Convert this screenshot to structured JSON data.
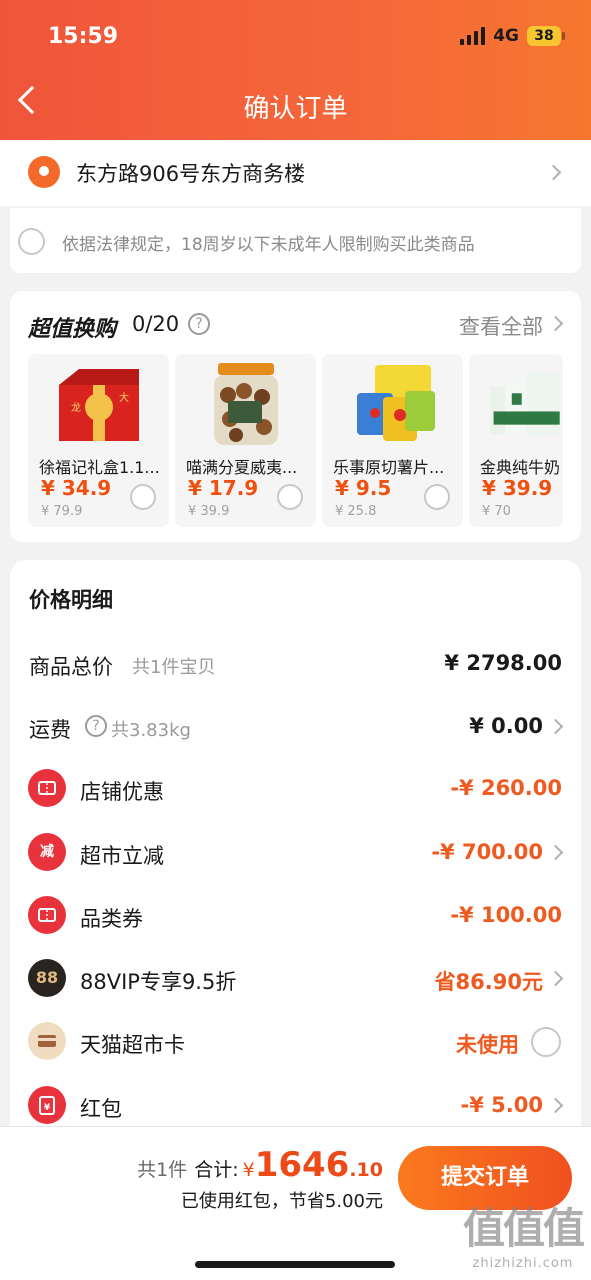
{
  "status_bar": {
    "time": "15:59",
    "network": "4G",
    "battery": "38"
  },
  "header": {
    "title": "确认订单"
  },
  "address": {
    "text": "东方路906号东方商务楼"
  },
  "legal": {
    "notice": "依据法律规定，18周岁以下未成年人限制购买此类商品"
  },
  "deals": {
    "title": "超值换购",
    "count": "0/20",
    "help": "?",
    "see_all": "查看全部",
    "items": [
      {
        "name": "徐福记礼盒1.1...",
        "price": "¥ 34.9",
        "original": "¥ 79.9"
      },
      {
        "name": "喵满分夏威夷...",
        "price": "¥ 17.9",
        "original": "¥ 39.9"
      },
      {
        "name": "乐事原切薯片...",
        "price": "¥ 9.5",
        "original": "¥ 25.8"
      },
      {
        "name": "金典纯牛奶",
        "price": "¥ 39.9",
        "original": "¥ 70"
      }
    ]
  },
  "price_detail": {
    "title": "价格明细",
    "total_goods": {
      "label": "商品总价",
      "sub": "共1件宝贝",
      "value": "¥ 2798.00"
    },
    "shipping": {
      "label": "运费",
      "help": "?",
      "sub": "共3.83kg",
      "value": "¥ 0.00"
    },
    "store_discount": {
      "label": "店铺优惠",
      "value": "-¥ 260.00"
    },
    "market_cut": {
      "label": "超市立减",
      "icon_text": "减",
      "value": "-¥ 700.00"
    },
    "category_coupon": {
      "label": "品类券",
      "value": "-¥ 100.00"
    },
    "vip": {
      "label": "88VIP专享9.5折",
      "icon_text": "88",
      "value": "省86.90元"
    },
    "tmall_card": {
      "label": "天猫超市卡",
      "value": "未使用"
    },
    "red_packet": {
      "label": "红包",
      "icon_text": "¥",
      "value": "-¥ 5.00"
    }
  },
  "bottom": {
    "count": "共1件",
    "total_label": "合计:",
    "yen": "¥",
    "total_int": "1646",
    "total_dec": ".10",
    "saving": "已使用红包，节省5.00元",
    "submit": "提交订单"
  },
  "watermark": {
    "brand": "值值值",
    "url": "zhizhizhi.com"
  },
  "colors": {
    "header": "#f5613a",
    "accent": "#ee5a1f",
    "submit": "#f46a1f"
  }
}
